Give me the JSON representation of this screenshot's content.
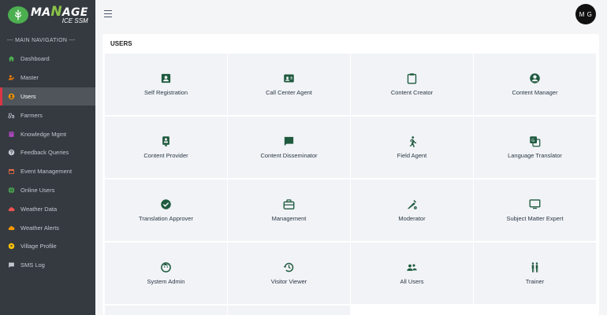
{
  "brand": {
    "main_prefix": "MA",
    "main_n": "N",
    "main_suffix": "AGE",
    "sub": "ICE SSM"
  },
  "sidebar": {
    "header": "--- MAIN NAVIGATION ---",
    "items": [
      {
        "label": "Dashboard",
        "icon": "home-icon",
        "color": "#4caf50"
      },
      {
        "label": "Master",
        "icon": "users-cog-icon",
        "color": "#f57c00"
      },
      {
        "label": "Users",
        "icon": "user-circle-icon",
        "color": "#ff9800"
      },
      {
        "label": "Farmers",
        "icon": "tractor-icon",
        "color": "#c2c7d0"
      },
      {
        "label": "Knowledge Mgmt",
        "icon": "book-icon",
        "color": "#ab47bc"
      },
      {
        "label": "Feedback Queries",
        "icon": "question-icon",
        "color": "#c2c7d0"
      },
      {
        "label": "Event Management",
        "icon": "calendar-icon",
        "color": "#ff7043"
      },
      {
        "label": "Online Users",
        "icon": "globe-icon",
        "color": "#4caf50"
      },
      {
        "label": "Weather Data",
        "icon": "cloud-icon",
        "color": "#ef5350"
      },
      {
        "label": "Weather Alerts",
        "icon": "cloud-alert-icon",
        "color": "#ff9800"
      },
      {
        "label": "Village Profile",
        "icon": "map-pin-icon",
        "color": "#ffc107"
      },
      {
        "label": "SMS Log",
        "icon": "message-icon",
        "color": "#c2c7d0"
      }
    ]
  },
  "header": {
    "avatar_initials": "M G"
  },
  "main": {
    "title": "USERS",
    "accent": "#1f5a3f",
    "tiles": [
      {
        "label": "Self Registration",
        "icon": "id-badge-icon"
      },
      {
        "label": "Call Center Agent",
        "icon": "contact-card-icon"
      },
      {
        "label": "Content Creator",
        "icon": "clipboard-icon"
      },
      {
        "label": "Content Manager",
        "icon": "account-circle-icon"
      },
      {
        "label": "Content Provider",
        "icon": "portrait-badge-icon"
      },
      {
        "label": "Content Disseminator",
        "icon": "chat-icon"
      },
      {
        "label": "Field Agent",
        "icon": "walking-person-icon"
      },
      {
        "label": "Language Translator",
        "icon": "translate-icon"
      },
      {
        "label": "Translation Approver",
        "icon": "check-circle-icon"
      },
      {
        "label": "Management",
        "icon": "briefcase-icon"
      },
      {
        "label": "Moderator",
        "icon": "edit-gear-icon"
      },
      {
        "label": "Subject Matter Expert",
        "icon": "monitor-icon"
      },
      {
        "label": "System Admin",
        "icon": "smiley-icon"
      },
      {
        "label": "Visitor Viewer",
        "icon": "history-icon"
      },
      {
        "label": "All Users",
        "icon": "people-icon"
      },
      {
        "label": "Trainer",
        "icon": "trainer-icon"
      }
    ]
  }
}
